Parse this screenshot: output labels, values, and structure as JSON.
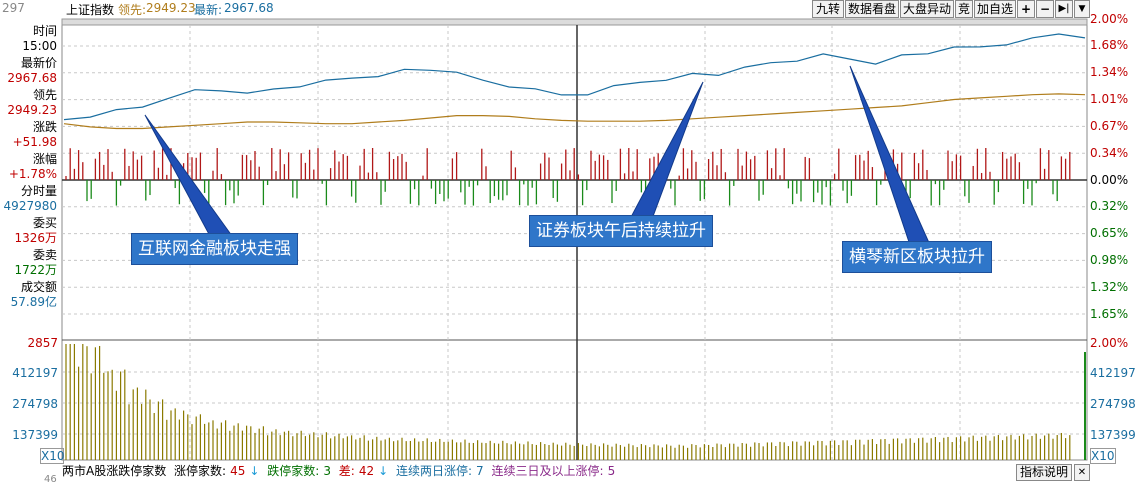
{
  "header": {
    "index_name": "上证指数",
    "lead_label": "领先:",
    "lead_value": "2949.23",
    "latest_label": "最新:",
    "latest_value": "2967.68",
    "top_left_tick": "297",
    "buttons": [
      "九转",
      "数据看盘",
      "大盘异动",
      "竞",
      "加自选"
    ],
    "icon_buttons": [
      "plus-icon",
      "minus-icon",
      "skip-to-end-icon",
      "dropdown-arrow-icon"
    ]
  },
  "info_panel": {
    "time_label": "时间",
    "time_value": "15:00",
    "last_price_label": "最新价",
    "last_price_value": "2967.68",
    "lead_label": "领先",
    "lead_value": "2949.23",
    "change_label": "涨跌",
    "change_value": "+51.98",
    "change_pct_label": "涨幅",
    "change_pct_value": "+1.78%",
    "min_volume_label": "分时量",
    "min_volume_value": "4927980",
    "bid_label": "委买",
    "bid_value": "1326万",
    "ask_label": "委卖",
    "ask_value": "1722万",
    "turnover_label": "成交额",
    "turnover_value": "57.89亿"
  },
  "price_axis_right": [
    "2.00%",
    "1.68%",
    "1.34%",
    "1.01%",
    "0.67%",
    "0.34%",
    "0.00%",
    "0.32%",
    "0.65%",
    "0.98%",
    "1.32%",
    "1.65%"
  ],
  "volume_axis_left": [
    "2857",
    "412197",
    "274798",
    "137399"
  ],
  "volume_axis_right": [
    "2.00%",
    "412197",
    "274798",
    "137399"
  ],
  "scale_label": "X10",
  "callouts": [
    "互联网金融板块走强",
    "证券板块午后持续拉升",
    "横琴新区板块拉升"
  ],
  "bottom_bar": {
    "title": "两市A股涨跌停家数",
    "limit_up_label": "涨停家数:",
    "limit_up_value": "45",
    "limit_down_label": "跌停家数:",
    "limit_down_value": "3",
    "diff_label": "差:",
    "diff_value": "42",
    "two_day_label": "连续两日涨停:",
    "two_day_value": "7",
    "three_day_label": "连续三日及以上涨停:",
    "three_day_value": "5",
    "indicator_button": "指标说明",
    "close_icon": "close-icon",
    "bottom_left_tick": "46"
  },
  "colors": {
    "price_line": "#1a6ea0",
    "avg_line": "#b07d1c",
    "up_bar": "#b01818",
    "down_bar": "#1a8a1a",
    "axis_up_text": "#c00000",
    "axis_down_text": "#006f00",
    "grid": "#c8c8c8",
    "volume_bar": "#8a7a00",
    "callout_bg": "#2f76c9"
  },
  "chart_data": [
    {
      "type": "line",
      "series": [
        {
          "values": [
            0.75,
            0.8,
            0.85,
            0.92,
            1.02,
            1.1,
            1.13,
            1.07,
            1.12,
            1.18,
            1.22,
            1.27,
            1.3,
            1.35,
            1.38,
            1.34,
            1.22,
            1.18,
            1.12,
            1.05,
            1.08,
            1.15,
            1.22,
            1.25,
            1.3,
            1.32,
            1.4,
            1.44,
            1.5,
            1.55,
            1.5,
            1.46,
            1.53,
            1.58,
            1.66,
            1.63,
            1.7,
            1.76,
            1.8,
            1.79
          ]
        },
        {
          "values": [
            0.7,
            0.66,
            0.64,
            0.64,
            0.66,
            0.68,
            0.7,
            0.72,
            0.72,
            0.71,
            0.7,
            0.7,
            0.72,
            0.74,
            0.77,
            0.8,
            0.8,
            0.79,
            0.76,
            0.74,
            0.73,
            0.73,
            0.73,
            0.74,
            0.76,
            0.78,
            0.8,
            0.82,
            0.84,
            0.86,
            0.88,
            0.9,
            0.92,
            0.96,
            1.0,
            1.02,
            1.04,
            1.06,
            1.07,
            1.06
          ]
        }
      ],
      "ylim": [
        -1.65,
        2.0
      ]
    },
    {
      "type": "bar",
      "values": [
        412000,
        380000,
        300000,
        240000,
        200000,
        170000,
        150000,
        130000,
        120000,
        110000,
        100000,
        95000,
        90000,
        85000,
        80000,
        75000,
        72000,
        70000,
        68000,
        66000,
        64000,
        62000,
        60000,
        58000,
        56000,
        55000,
        54000,
        53000,
        52000,
        51000,
        50000,
        52000,
        54000,
        56000,
        58000,
        60000,
        62000,
        64000,
        66000,
        68000,
        70000,
        72000,
        74000,
        76000,
        78000,
        80000,
        82000,
        84000,
        86000,
        88000
      ],
      "ylim": [
        0,
        412197
      ]
    }
  ]
}
